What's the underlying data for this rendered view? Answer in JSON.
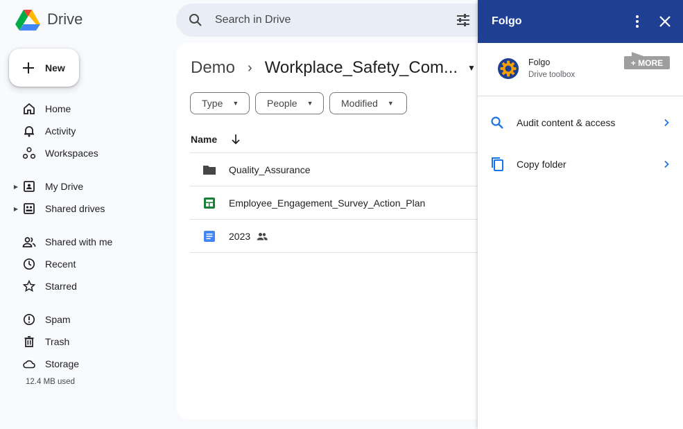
{
  "app": {
    "name": "Drive"
  },
  "search": {
    "placeholder": "Search in Drive"
  },
  "new_button": {
    "label": "New"
  },
  "sidebar": {
    "items": [
      {
        "label": "Home",
        "icon": "home-icon"
      },
      {
        "label": "Activity",
        "icon": "bell-icon"
      },
      {
        "label": "Workspaces",
        "icon": "workspaces-icon"
      },
      {
        "label": "My Drive",
        "icon": "my-drive-icon"
      },
      {
        "label": "Shared drives",
        "icon": "shared-drives-icon"
      },
      {
        "label": "Shared with me",
        "icon": "people-icon"
      },
      {
        "label": "Recent",
        "icon": "clock-icon"
      },
      {
        "label": "Starred",
        "icon": "star-icon"
      },
      {
        "label": "Spam",
        "icon": "spam-icon"
      },
      {
        "label": "Trash",
        "icon": "trash-icon"
      },
      {
        "label": "Storage",
        "icon": "cloud-icon"
      }
    ],
    "storage_used": "12.4 MB used"
  },
  "breadcrumb": {
    "root": "Demo",
    "current": "Workplace_Safety_Com..."
  },
  "filters": {
    "type": "Type",
    "people": "People",
    "modified": "Modified"
  },
  "list": {
    "column_name": "Name",
    "rows": [
      {
        "name": "Quality_Assurance",
        "kind": "folder-icon"
      },
      {
        "name": "Employee_Engagement_Survey_Action_Plan",
        "kind": "sheets-icon"
      },
      {
        "name": "2023",
        "kind": "docs-icon",
        "shared": true
      }
    ]
  },
  "panel": {
    "title": "Folgo",
    "addon_name": "Folgo",
    "addon_subtitle": "Drive toolbox",
    "more_label": "+ MORE",
    "items": [
      {
        "label": "Audit content & access",
        "icon": "search-icon"
      },
      {
        "label": "Copy folder",
        "icon": "copy-icon"
      }
    ]
  },
  "colors": {
    "panel_header": "#1f3f93",
    "accent_blue": "#1a73e8",
    "sheets_green": "#188038",
    "docs_blue": "#4285f4"
  }
}
